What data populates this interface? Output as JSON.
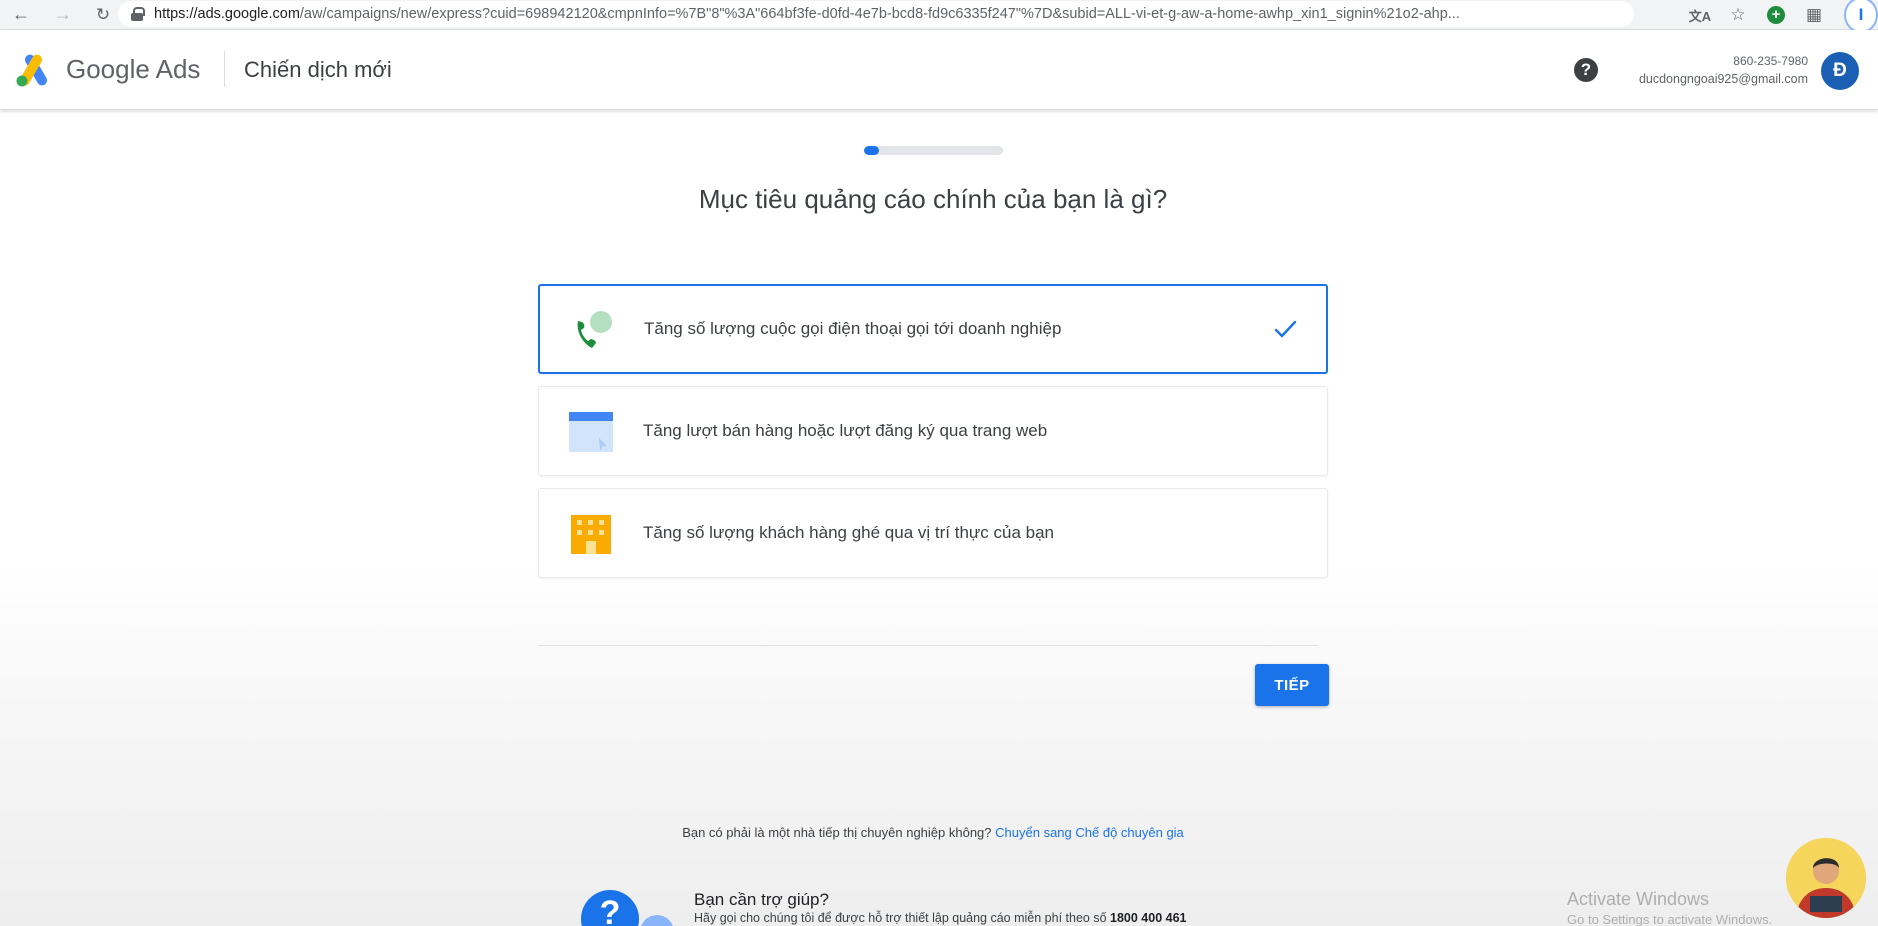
{
  "browser": {
    "url_host": "https://ads.google.com",
    "url_path": "/aw/campaigns/new/express?cuid=698942120&cmpnInfo=%7B\"8\"%3A\"664bf3fe-d0fd-4e7b-bcd8-fd9c6335f247\"%7D&subid=ALL-vi-et-g-aw-a-home-awhp_xin1_signin%21o2-ahp...",
    "profile_initial": "I"
  },
  "header": {
    "product_name": "Google Ads",
    "page_title": "Chiến dịch mới",
    "account_phone": "860-235-7980",
    "account_email": "ducdongngoai925@gmail.com",
    "avatar_initial": "Đ"
  },
  "wizard": {
    "progress_fraction": 0.11,
    "question": "Mục tiêu quảng cáo chính của bạn là gì?",
    "options": [
      {
        "label": "Tăng số lượng cuộc gọi điện thoại gọi tới doanh nghiệp",
        "icon": "phone-call-icon",
        "selected": true
      },
      {
        "label": "Tăng lượt bán hàng hoặc lượt đăng ký qua trang web",
        "icon": "browser-window-icon",
        "selected": false
      },
      {
        "label": "Tăng số lượng khách hàng ghé qua vị trí thực của bạn",
        "icon": "storefront-building-icon",
        "selected": false
      }
    ],
    "next_label": "TIẾP"
  },
  "footer": {
    "expert_question": "Bạn có phải là một nhà tiếp thị chuyên nghiệp không?",
    "expert_link": "Chuyển sang Chế độ chuyên gia",
    "help_title": "Bạn cần trợ giúp?",
    "help_body": "Hãy gọi cho chúng tôi để được hỗ trợ thiết lập quảng cáo miễn phí theo số",
    "help_phone": "1800 400 461"
  },
  "overlay": {
    "activate_title": "Activate Windows",
    "activate_sub": "Go to Settings to activate Windows."
  },
  "colors": {
    "accent": "#1a73e8",
    "phone_green": "#1e8e3e",
    "building_yellow": "#f9ab00"
  }
}
